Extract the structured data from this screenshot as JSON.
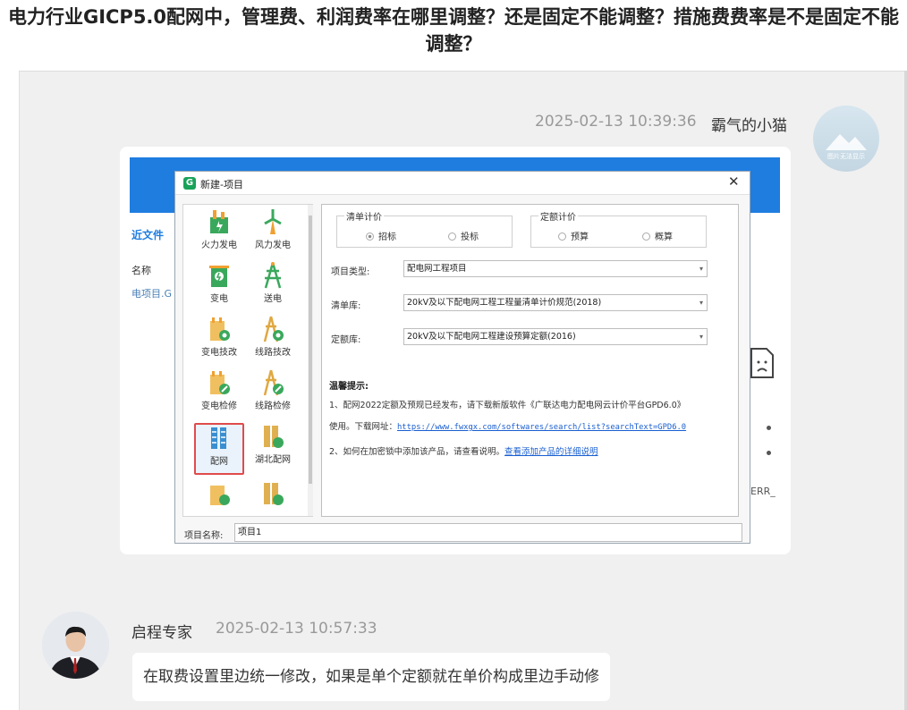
{
  "page": {
    "title": "电力行业GICP5.0配网中，管理费、利润费率在哪里调整？还是固定不能调整？措施费费率是不是固定不能调整？"
  },
  "message1": {
    "time": "2025-02-13 10:39:36",
    "author": "霸气的小猫",
    "avatar_caption": "图片无法显示",
    "screenshot": {
      "background": {
        "recent_files": "近文件",
        "name_header": "名称",
        "file_item": "电项目.G",
        "err_text": "ERR_"
      },
      "dialog": {
        "title": "新建-项目",
        "close": "✕",
        "categories": [
          {
            "label": "火力发电",
            "icon": "thermal-power-icon"
          },
          {
            "label": "风力发电",
            "icon": "wind-power-icon"
          },
          {
            "label": "变电",
            "icon": "substation-icon"
          },
          {
            "label": "送电",
            "icon": "transmission-icon"
          },
          {
            "label": "变电技改",
            "icon": "substation-retrofit-icon"
          },
          {
            "label": "线路技改",
            "icon": "line-retrofit-icon"
          },
          {
            "label": "变电检修",
            "icon": "substation-maintenance-icon"
          },
          {
            "label": "线路检修",
            "icon": "line-maintenance-icon"
          },
          {
            "label": "配网",
            "icon": "distribution-network-icon",
            "selected": true
          },
          {
            "label": "湖北配网",
            "icon": "hubei-distribution-icon"
          }
        ],
        "bill_pricing": {
          "legend": "清单计价",
          "options": [
            "招标",
            "投标"
          ],
          "selected": "招标"
        },
        "quota_pricing": {
          "legend": "定额计价",
          "options": [
            "预算",
            "概算"
          ]
        },
        "project_type": {
          "label": "项目类型:",
          "value": "配电网工程项目"
        },
        "bill_library": {
          "label": "清单库:",
          "value": "20kV及以下配电网工程工程量清单计价规范(2018)"
        },
        "quota_library": {
          "label": "定额库:",
          "value": "20kV及以下配电网工程建设预算定额(2016)"
        },
        "tips": {
          "title": "温馨提示:",
          "line1": "1、配网2022定额及预规已经发布，请下载新版软件《广联达电力配电网云计价平台GPD6.0》",
          "line2_prefix": "使用。下载网址：",
          "line2_link": "https://www.fwxgx.com/softwares/search/list?searchText=GPD6.0",
          "line3_prefix": "2、如何在加密锁中添加该产品，请查看说明。",
          "line3_link": "查看添加产品的详细说明"
        },
        "project_name": {
          "label": "项目名称:",
          "value": "项目1"
        }
      }
    }
  },
  "message2": {
    "author": "启程专家",
    "time": "2025-02-13 10:57:33",
    "text": "在取费设置里边统一修改，如果是单个定额就在单价构成里边手动修"
  }
}
